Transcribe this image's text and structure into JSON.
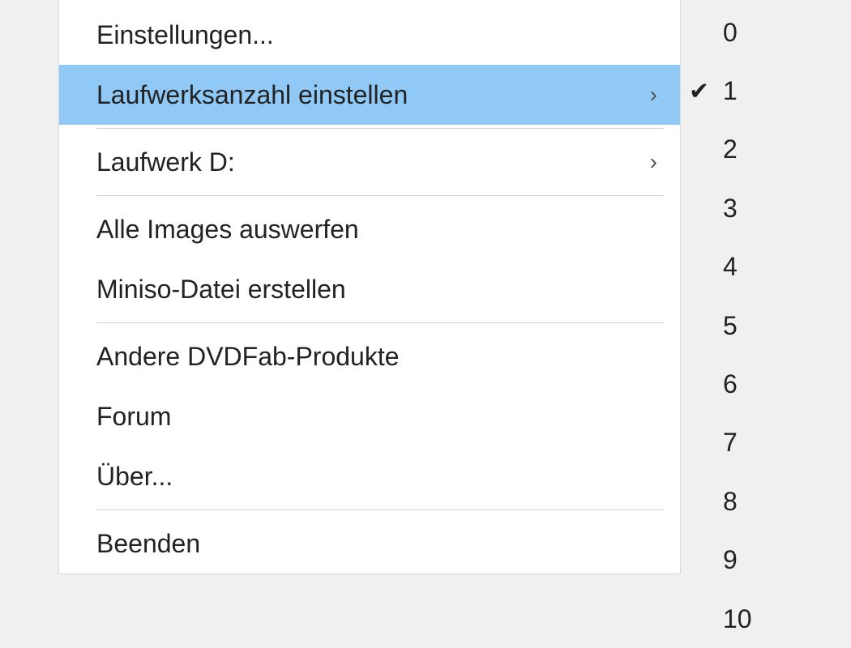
{
  "menu": {
    "settings": "Einstellungen...",
    "set_drive_count": "Laufwerksanzahl einstellen",
    "drive_d": "Laufwerk D:",
    "eject_all_images": "Alle Images auswerfen",
    "create_miniso": "Miniso-Datei erstellen",
    "other_products": "Andere DVDFab-Produkte",
    "forum": "Forum",
    "about": "Über...",
    "exit": "Beenden"
  },
  "submenu": {
    "selected": "1",
    "options": [
      "0",
      "1",
      "2",
      "3",
      "4",
      "5",
      "6",
      "7",
      "8",
      "9",
      "10"
    ],
    "checkmark": "✔"
  },
  "glyphs": {
    "submenu_arrow": "›"
  }
}
